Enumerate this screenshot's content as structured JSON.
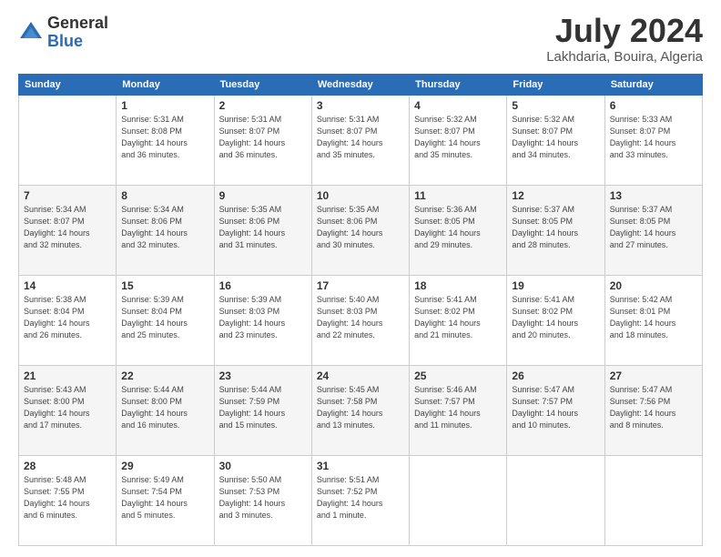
{
  "logo": {
    "general": "General",
    "blue": "Blue"
  },
  "title": "July 2024",
  "location": "Lakhdaria, Bouira, Algeria",
  "weekdays": [
    "Sunday",
    "Monday",
    "Tuesday",
    "Wednesday",
    "Thursday",
    "Friday",
    "Saturday"
  ],
  "weeks": [
    [
      {
        "day": "",
        "info": ""
      },
      {
        "day": "1",
        "info": "Sunrise: 5:31 AM\nSunset: 8:08 PM\nDaylight: 14 hours\nand 36 minutes."
      },
      {
        "day": "2",
        "info": "Sunrise: 5:31 AM\nSunset: 8:07 PM\nDaylight: 14 hours\nand 36 minutes."
      },
      {
        "day": "3",
        "info": "Sunrise: 5:31 AM\nSunset: 8:07 PM\nDaylight: 14 hours\nand 35 minutes."
      },
      {
        "day": "4",
        "info": "Sunrise: 5:32 AM\nSunset: 8:07 PM\nDaylight: 14 hours\nand 35 minutes."
      },
      {
        "day": "5",
        "info": "Sunrise: 5:32 AM\nSunset: 8:07 PM\nDaylight: 14 hours\nand 34 minutes."
      },
      {
        "day": "6",
        "info": "Sunrise: 5:33 AM\nSunset: 8:07 PM\nDaylight: 14 hours\nand 33 minutes."
      }
    ],
    [
      {
        "day": "7",
        "info": "Sunrise: 5:34 AM\nSunset: 8:07 PM\nDaylight: 14 hours\nand 32 minutes."
      },
      {
        "day": "8",
        "info": "Sunrise: 5:34 AM\nSunset: 8:06 PM\nDaylight: 14 hours\nand 32 minutes."
      },
      {
        "day": "9",
        "info": "Sunrise: 5:35 AM\nSunset: 8:06 PM\nDaylight: 14 hours\nand 31 minutes."
      },
      {
        "day": "10",
        "info": "Sunrise: 5:35 AM\nSunset: 8:06 PM\nDaylight: 14 hours\nand 30 minutes."
      },
      {
        "day": "11",
        "info": "Sunrise: 5:36 AM\nSunset: 8:05 PM\nDaylight: 14 hours\nand 29 minutes."
      },
      {
        "day": "12",
        "info": "Sunrise: 5:37 AM\nSunset: 8:05 PM\nDaylight: 14 hours\nand 28 minutes."
      },
      {
        "day": "13",
        "info": "Sunrise: 5:37 AM\nSunset: 8:05 PM\nDaylight: 14 hours\nand 27 minutes."
      }
    ],
    [
      {
        "day": "14",
        "info": "Sunrise: 5:38 AM\nSunset: 8:04 PM\nDaylight: 14 hours\nand 26 minutes."
      },
      {
        "day": "15",
        "info": "Sunrise: 5:39 AM\nSunset: 8:04 PM\nDaylight: 14 hours\nand 25 minutes."
      },
      {
        "day": "16",
        "info": "Sunrise: 5:39 AM\nSunset: 8:03 PM\nDaylight: 14 hours\nand 23 minutes."
      },
      {
        "day": "17",
        "info": "Sunrise: 5:40 AM\nSunset: 8:03 PM\nDaylight: 14 hours\nand 22 minutes."
      },
      {
        "day": "18",
        "info": "Sunrise: 5:41 AM\nSunset: 8:02 PM\nDaylight: 14 hours\nand 21 minutes."
      },
      {
        "day": "19",
        "info": "Sunrise: 5:41 AM\nSunset: 8:02 PM\nDaylight: 14 hours\nand 20 minutes."
      },
      {
        "day": "20",
        "info": "Sunrise: 5:42 AM\nSunset: 8:01 PM\nDaylight: 14 hours\nand 18 minutes."
      }
    ],
    [
      {
        "day": "21",
        "info": "Sunrise: 5:43 AM\nSunset: 8:00 PM\nDaylight: 14 hours\nand 17 minutes."
      },
      {
        "day": "22",
        "info": "Sunrise: 5:44 AM\nSunset: 8:00 PM\nDaylight: 14 hours\nand 16 minutes."
      },
      {
        "day": "23",
        "info": "Sunrise: 5:44 AM\nSunset: 7:59 PM\nDaylight: 14 hours\nand 15 minutes."
      },
      {
        "day": "24",
        "info": "Sunrise: 5:45 AM\nSunset: 7:58 PM\nDaylight: 14 hours\nand 13 minutes."
      },
      {
        "day": "25",
        "info": "Sunrise: 5:46 AM\nSunset: 7:57 PM\nDaylight: 14 hours\nand 11 minutes."
      },
      {
        "day": "26",
        "info": "Sunrise: 5:47 AM\nSunset: 7:57 PM\nDaylight: 14 hours\nand 10 minutes."
      },
      {
        "day": "27",
        "info": "Sunrise: 5:47 AM\nSunset: 7:56 PM\nDaylight: 14 hours\nand 8 minutes."
      }
    ],
    [
      {
        "day": "28",
        "info": "Sunrise: 5:48 AM\nSunset: 7:55 PM\nDaylight: 14 hours\nand 6 minutes."
      },
      {
        "day": "29",
        "info": "Sunrise: 5:49 AM\nSunset: 7:54 PM\nDaylight: 14 hours\nand 5 minutes."
      },
      {
        "day": "30",
        "info": "Sunrise: 5:50 AM\nSunset: 7:53 PM\nDaylight: 14 hours\nand 3 minutes."
      },
      {
        "day": "31",
        "info": "Sunrise: 5:51 AM\nSunset: 7:52 PM\nDaylight: 14 hours\nand 1 minute."
      },
      {
        "day": "",
        "info": ""
      },
      {
        "day": "",
        "info": ""
      },
      {
        "day": "",
        "info": ""
      }
    ]
  ]
}
